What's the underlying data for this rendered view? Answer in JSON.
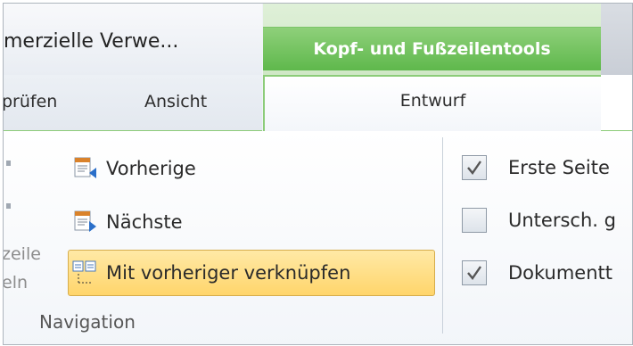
{
  "title_bar": {
    "document_title": "merzielle Verwe...",
    "contextual_tab_group": "Kopf- und Fußzeilentools"
  },
  "tabs": {
    "items": [
      {
        "label": "prüfen"
      },
      {
        "label": "Ansicht"
      },
      {
        "label": "Entwurf",
        "active": true
      }
    ]
  },
  "left_group": {
    "line1": "zeile",
    "line2": "eln"
  },
  "navigation": {
    "previous_label": "Vorherige",
    "next_label": "Nächste",
    "link_label": "Mit vorheriger verknüpfen",
    "group_label": "Navigation"
  },
  "options": {
    "first_page": {
      "label": "Erste Seite",
      "checked": true
    },
    "different": {
      "label": "Untersch. g",
      "checked": false
    },
    "document": {
      "label": "Dokumentt",
      "checked": true
    }
  },
  "colors": {
    "context_green": "#5fb84c",
    "highlight": "#ffd56b",
    "tab_border": "#8ccc79"
  }
}
